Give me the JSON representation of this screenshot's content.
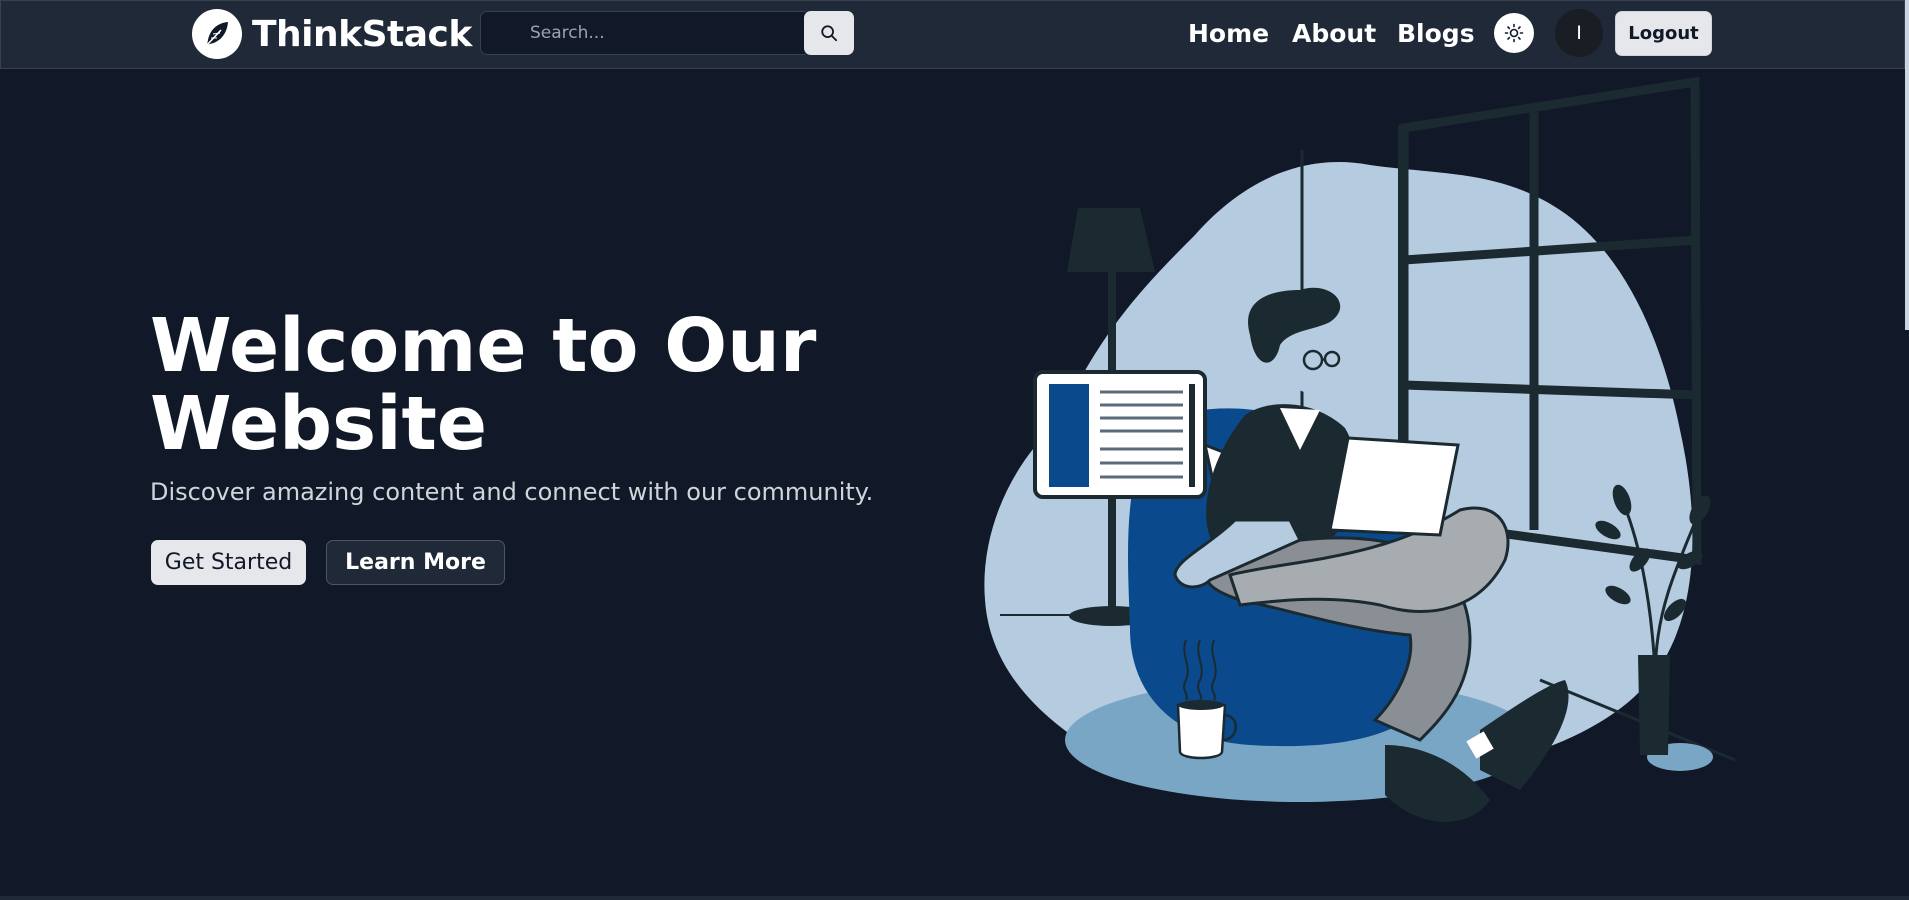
{
  "navbar": {
    "brand": "ThinkStack",
    "search_placeholder": "Search...",
    "links": [
      "Home",
      "About",
      "Blogs"
    ],
    "avatar_initial": "I",
    "logout_label": "Logout"
  },
  "hero": {
    "title": "Welcome to Our Website",
    "subtitle": "Discover amazing content and connect with our community.",
    "primary_button": "Get Started",
    "secondary_button": "Learn More"
  },
  "icons": {
    "logo": "feather-icon",
    "search": "search-icon",
    "theme": "sun-icon"
  },
  "colors": {
    "background": "#111827",
    "navbar": "#1f2937",
    "button_light": "#e5e7eb",
    "accent_blue": "#0a4a8c",
    "illustration_blob": "#b4cbe0"
  }
}
